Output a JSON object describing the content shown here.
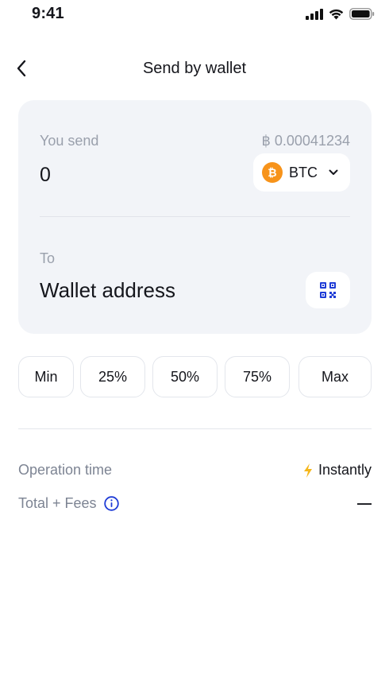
{
  "status_bar": {
    "time": "9:41"
  },
  "nav": {
    "title": "Send by wallet"
  },
  "send": {
    "label": "You send",
    "balance": "฿ 0.00041234",
    "amount": "0",
    "coin": {
      "symbol": "₿",
      "name": "BTC",
      "color": "#f7931a"
    }
  },
  "recipient": {
    "label": "To",
    "placeholder": "Wallet address"
  },
  "percent_buttons": [
    "Min",
    "25%",
    "50%",
    "75%",
    "Max"
  ],
  "info": {
    "operation_time_label": "Operation time",
    "operation_time_value": "Instantly",
    "total_fees_label": "Total + Fees",
    "total_fees_value": "—"
  },
  "colors": {
    "accent": "#1f3cd6",
    "card_bg": "#f2f4f8",
    "bolt": "#f5b71c"
  }
}
